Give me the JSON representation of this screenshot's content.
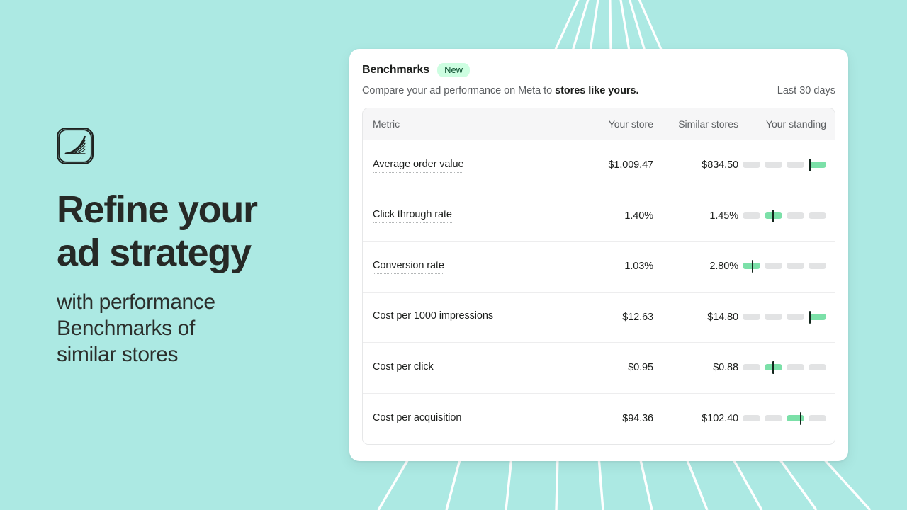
{
  "promo": {
    "logo_icon": "shopify-swoosh-icon",
    "headline_line1": "Refine your",
    "headline_line2": "ad strategy",
    "subline_line1": "with performance",
    "subline_line2": "Benchmarks of",
    "subline_line3": "similar stores"
  },
  "card": {
    "title": "Benchmarks",
    "badge": "New",
    "subtitle_prefix": "Compare your ad performance on Meta to ",
    "subtitle_link": "stores like yours.",
    "period": "Last 30 days"
  },
  "table": {
    "headers": {
      "metric": "Metric",
      "your_store": "Your store",
      "similar_stores": "Similar stores",
      "your_standing": "Your standing"
    },
    "rows": [
      {
        "metric": "Average order value",
        "your_store": "$1,009.47",
        "similar_stores": "$834.50",
        "standing_segments": [
          false,
          false,
          false,
          true
        ],
        "marker_segment": 4,
        "marker_offset_pct": 8
      },
      {
        "metric": "Click through rate",
        "your_store": "1.40%",
        "similar_stores": "1.45%",
        "standing_segments": [
          false,
          true,
          false,
          false
        ],
        "marker_segment": 2,
        "marker_offset_pct": 50
      },
      {
        "metric": "Conversion rate",
        "your_store": "1.03%",
        "similar_stores": "2.80%",
        "standing_segments": [
          true,
          false,
          false,
          false
        ],
        "marker_segment": 1,
        "marker_offset_pct": 55
      },
      {
        "metric": "Cost per 1000 impressions",
        "your_store": "$12.63",
        "similar_stores": "$14.80",
        "standing_segments": [
          false,
          false,
          false,
          true
        ],
        "marker_segment": 4,
        "marker_offset_pct": 8
      },
      {
        "metric": "Cost per click",
        "your_store": "$0.95",
        "similar_stores": "$0.88",
        "standing_segments": [
          false,
          true,
          false,
          false
        ],
        "marker_segment": 2,
        "marker_offset_pct": 50
      },
      {
        "metric": "Cost per acquisition",
        "your_store": "$94.36",
        "similar_stores": "$102.40",
        "standing_segments": [
          false,
          false,
          true,
          false
        ],
        "marker_segment": 3,
        "marker_offset_pct": 80
      }
    ]
  },
  "colors": {
    "background": "#ACE9E3",
    "accent_green": "#7BE0A8",
    "badge_bg": "#CDFEE1",
    "segment_off": "#E2E3E4",
    "marker": "#12261C",
    "card_bg": "#FFFFFF",
    "text_primary": "#1D1F1D",
    "text_secondary": "#5C5F62"
  }
}
